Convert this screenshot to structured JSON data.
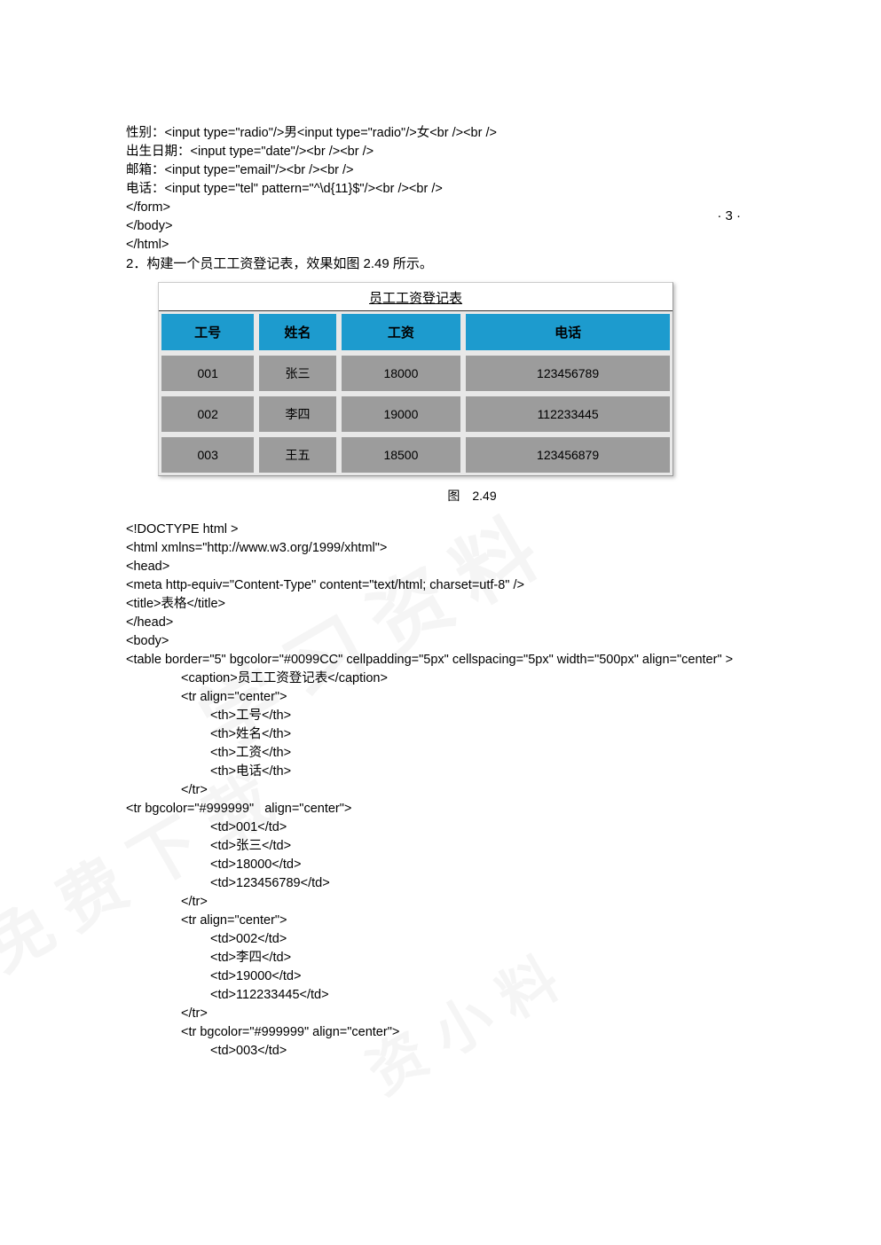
{
  "page_number": "· 3 ·",
  "code_block_1": {
    "l1": "性别：<input type=\"radio\"/>男<input type=\"radio\"/>女<br /><br />",
    "l2": "出生日期：<input type=\"date\"/><br /><br />",
    "l3": "邮箱：<input type=\"email\"/><br /><br />",
    "l4": "电话：<input type=\"tel\" pattern=\"^\\d{11}$\"/><br /><br />",
    "l5": "</form>",
    "l6": "</body>",
    "l7": "</html>"
  },
  "narrative": "2．构建一个员工工资登记表，效果如图 2.49 所示。",
  "table": {
    "caption": "员工工资登记表",
    "headers": [
      "工号",
      "姓名",
      "工资",
      "电话"
    ],
    "rows": [
      [
        "001",
        "张三",
        "18000",
        "123456789"
      ],
      [
        "002",
        "李四",
        "19000",
        "112233445"
      ],
      [
        "003",
        "王五",
        "18500",
        "123456879"
      ]
    ]
  },
  "figure_caption": "图　2.49",
  "code_block_2": {
    "l1": "<!DOCTYPE html >",
    "l2": "<html xmlns=\"http://www.w3.org/1999/xhtml\">",
    "l3": "<head>",
    "l4": "<meta http-equiv=\"Content-Type\" content=\"text/html; charset=utf-8\" />",
    "l5": "<title>表格</title>",
    "l6": "</head>",
    "l7": "<body>",
    "l8": "<table border=\"5\" bgcolor=\"#0099CC\" cellpadding=\"5px\" cellspacing=\"5px\" width=\"500px\" align=\"center\" >",
    "l9": "<caption>员工工资登记表</caption>",
    "l10": "<tr align=\"center\">",
    "l11": "<th>工号</th>",
    "l12": "<th>姓名</th>",
    "l13": "<th>工资</th>",
    "l14": "<th>电话</th>",
    "l15": "</tr>",
    "l16": "<tr bgcolor=\"#999999\"   align=\"center\">",
    "l17": "<td>001</td>",
    "l18": "<td>张三</td>",
    "l19": "<td>18000</td>",
    "l20": "<td>123456789</td>",
    "l21": "</tr>",
    "l22": "<tr align=\"center\">",
    "l23": "<td>002</td>",
    "l24": "<td>李四</td>",
    "l25": "<td>19000</td>",
    "l26": "<td>112233445</td>",
    "l27": "</tr>",
    "l28": "<tr bgcolor=\"#999999\" align=\"center\">",
    "l29": "<td>003</td>"
  },
  "watermarks": {
    "w1": "学习资料",
    "w2": "免费下载",
    "w3": "资小料"
  }
}
